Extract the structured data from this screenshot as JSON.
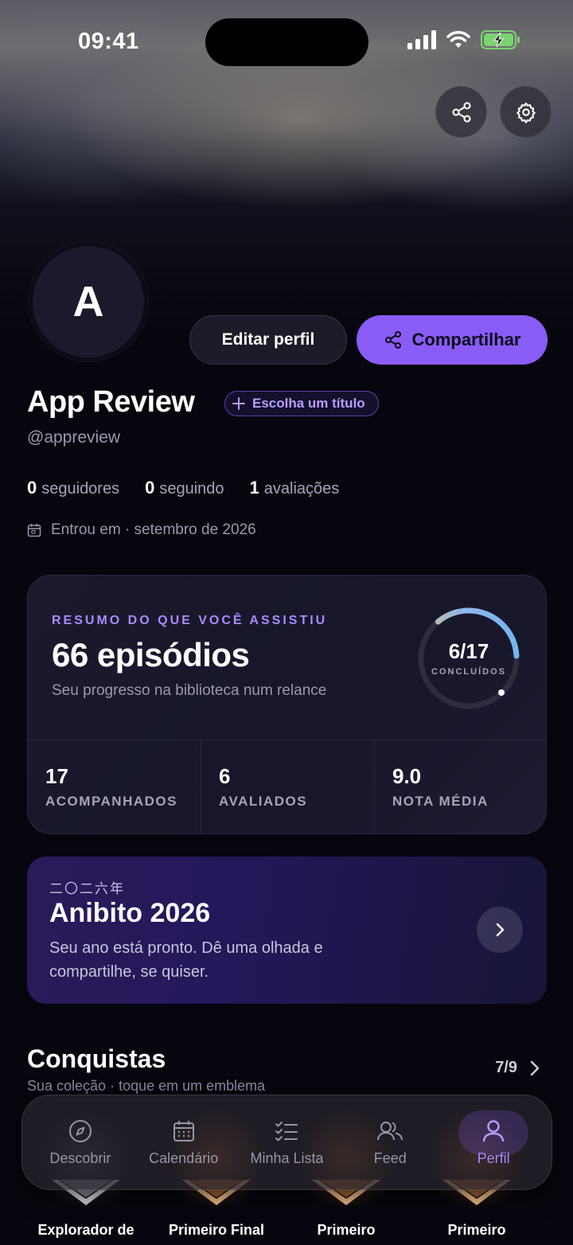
{
  "status_bar": {
    "time": "09:41"
  },
  "profile": {
    "avatar_initial": "A",
    "name": "App Review",
    "title_chip": "Escolha um título",
    "handle": "@appreview",
    "edit_label": "Editar perfil",
    "share_label": "Compartilhar",
    "stats": [
      {
        "value": "0",
        "label": "seguidores"
      },
      {
        "value": "0",
        "label": "seguindo"
      },
      {
        "value": "1",
        "label": "avaliações"
      }
    ],
    "joined": "Entrou em · setembro de 2026"
  },
  "summary": {
    "label": "RESUMO DO QUE VOCÊ ASSISTIU",
    "value": "66 episódios",
    "subtitle": "Seu progresso na biblioteca num relance",
    "ring_value": "6/17",
    "ring_label": "CONCLUÍDOS",
    "completed": 6,
    "total": 17,
    "metrics": [
      {
        "value": "17",
        "label": "ACOMPANHADOS"
      },
      {
        "value": "6",
        "label": "AVALIADOS"
      },
      {
        "value": "9.0",
        "label": "NOTA MÉDIA"
      }
    ]
  },
  "recap": {
    "kanji": "二〇二六年",
    "title": "Anibito 2026",
    "description": "Seu ano está pronto. Dê uma olhada e compartilhe, se quiser."
  },
  "achievements": {
    "title": "Conquistas",
    "subtitle": "Sua coleção · toque em um emblema",
    "count": "7/9",
    "badges": [
      {
        "name": "Explorador de"
      },
      {
        "name": "Primeiro Final"
      },
      {
        "name": "Primeiro"
      },
      {
        "name": "Primeiro"
      }
    ]
  },
  "tabs": [
    {
      "label": "Descobrir",
      "icon": "compass-icon"
    },
    {
      "label": "Calendário",
      "icon": "calendar-icon"
    },
    {
      "label": "Minha Lista",
      "icon": "checklist-icon"
    },
    {
      "label": "Feed",
      "icon": "users-icon"
    },
    {
      "label": "Perfil",
      "icon": "user-icon",
      "active": true
    }
  ],
  "colors": {
    "accent": "#8a5cf6",
    "background": "#07060e",
    "card": "#1b1a2c"
  }
}
